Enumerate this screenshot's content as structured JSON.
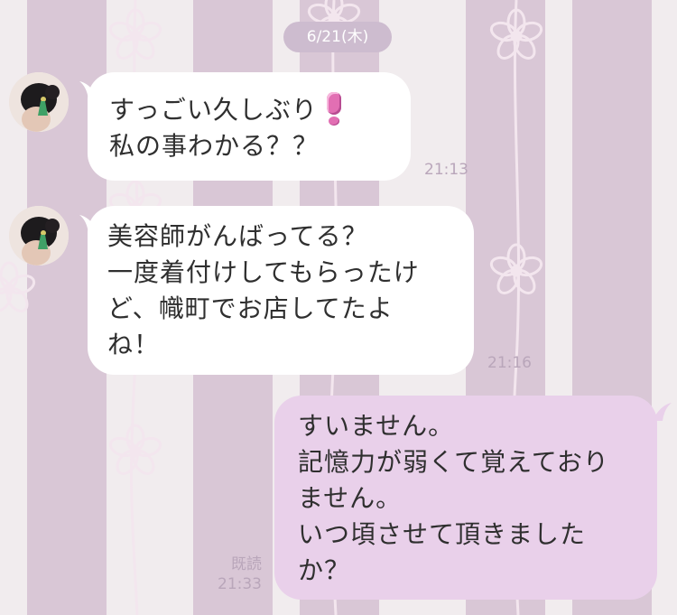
{
  "chat": {
    "date": "6/21(木)",
    "messages": [
      {
        "sender": "other",
        "lines": [
          "すっごい久しぶり",
          "私の事わかる？？"
        ],
        "emoji": "pink-exclamation",
        "time": "21:13"
      },
      {
        "sender": "other",
        "lines": [
          "美容師がんばってる？",
          "一度着付けしてもらったけ",
          "ど、幟町でお店してたよ",
          "ね！"
        ],
        "time": "21:16"
      },
      {
        "sender": "me",
        "lines": [
          "すいません。",
          "記憶力が弱くて覚えており",
          "ません。",
          "いつ頃させて頂きました",
          "か？"
        ],
        "read_label": "既読",
        "time": "21:33"
      }
    ]
  },
  "colors": {
    "stripe_light": "#f1ecee",
    "stripe_purple": "#d9c7d6",
    "bubble_incoming": "#ffffff",
    "bubble_outgoing": "#e9d0ea",
    "meta_text": "#b9a6ba"
  },
  "icons": {
    "avatar": "profile-avatar-hair-ornament",
    "emoji": "pink-exclamation-icon"
  }
}
